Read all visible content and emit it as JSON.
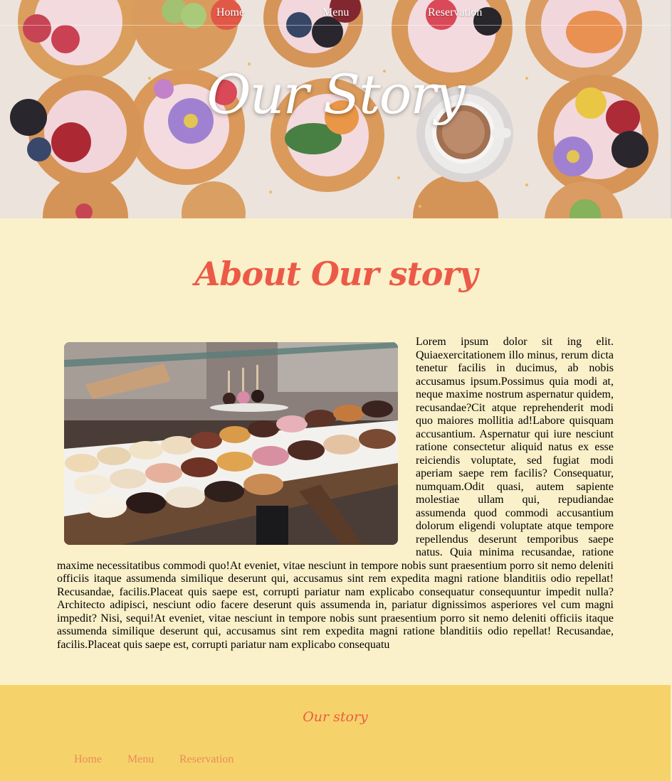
{
  "nav": {
    "items": [
      {
        "label": "Home"
      },
      {
        "label": "Menu"
      },
      {
        "label": "Reservation"
      }
    ]
  },
  "hero": {
    "title": "Our Story"
  },
  "about": {
    "title": "About Our story",
    "text": "Lorem ipsum dolor sit ing elit. Quiaexercitationem illo minus, rerum dicta tenetur facilis in ducimus, ab nobis accusamus ipsum.Possimus quia modi at, neque maxime nostrum aspernatur quidem, recusandae?Cit atque reprehenderit modi quo maiores mollitia ad!Labore quisquam accusantium. Aspernatur qui iure nesciunt ratione consectetur aliquid natus ex esse reiciendis voluptate, sed fugiat modi aperiam saepe rem facilis? Consequatur, numquam.Odit quasi, autem sapiente molestiae ullam qui, repudiandae assumenda quod commodi accusantium dolorum eligendi voluptate atque tempore repellendus deserunt temporibus saepe natus. Quia minima recusandae, ratione maxime necessitatibus commodi quo!At eveniet, vitae nesciunt in tempore nobis sunt praesentium porro sit nemo deleniti officiis itaque assumenda similique deserunt qui, accusamus sint rem expedita magni ratione blanditiis odio repellat! Recusandae, facilis.Placeat quis saepe est, corrupti pariatur nam explicabo consequatur consequuntur impedit nulla? Architecto adipisci, nesciunt odio facere deserunt quis assumenda in, pariatur dignissimos asperiores vel cum magni impedit? Nisi, sequi!At eveniet, vitae nesciunt in tempore nobis sunt praesentium porro sit nemo deleniti officiis itaque assumenda similique deserunt qui, accusamus sint rem expedita magni ratione blanditiis odio repellat! Recusandae, facilis.Placeat quis saepe est, corrupti pariatur nam explicabo consequatu"
  },
  "footer": {
    "title": "Our story",
    "nav": [
      {
        "label": "Home"
      },
      {
        "label": "Menu"
      },
      {
        "label": "Reservation"
      }
    ]
  },
  "colors": {
    "page_background": "#faf0c9",
    "accent": "#ec5a47",
    "footer_background": "#f5d36a",
    "footer_link": "#ec8a5a"
  }
}
